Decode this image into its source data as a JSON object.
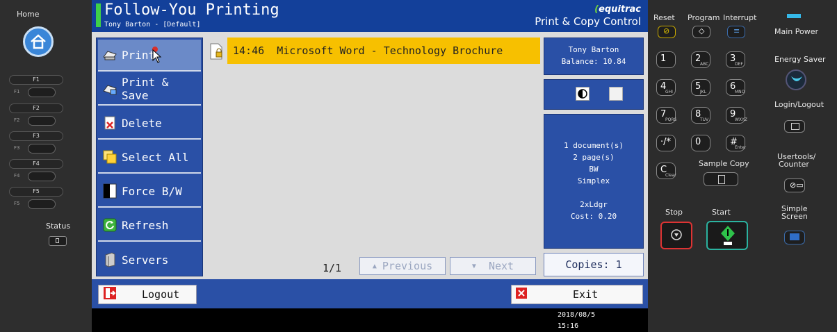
{
  "left_panel": {
    "home_label": "Home",
    "fkeys": [
      {
        "label": "F1",
        "small": "F1"
      },
      {
        "label": "F2",
        "small": "F2"
      },
      {
        "label": "F3",
        "small": "F3"
      },
      {
        "label": "F4",
        "small": "F4"
      },
      {
        "label": "F5",
        "small": "F5"
      }
    ],
    "status_label": "Status"
  },
  "header": {
    "title": "Follow-You Printing",
    "user": "Tony Barton - [Default]",
    "brand": "equitrac",
    "subtitle": "Print & Copy Control"
  },
  "sidebar": {
    "items": [
      {
        "label": "Print",
        "icon": "printer-icon"
      },
      {
        "label": "Print & Save",
        "icon": "print-save-icon"
      },
      {
        "label": "Delete",
        "icon": "delete-icon"
      },
      {
        "label": "Select All",
        "icon": "select-all-icon"
      },
      {
        "label": "Force B/W",
        "icon": "force-bw-icon"
      },
      {
        "label": "Refresh",
        "icon": "refresh-icon"
      },
      {
        "label": "Servers",
        "icon": "servers-icon"
      }
    ]
  },
  "job": {
    "time": "14:46",
    "name": "Microsoft Word - Technology Brochure"
  },
  "pagination": {
    "counter": "1/1",
    "previous": "Previous",
    "next": "Next"
  },
  "user_box": {
    "name": "Tony Barton",
    "balance": "Balance: 10.84"
  },
  "summary": {
    "documents": "1 document(s)",
    "pages": "2 page(s)",
    "color": "BW",
    "duplex": "Simplex",
    "paper": "2xLdgr",
    "cost": "Cost: 0.20"
  },
  "copies": "Copies: 1",
  "bottom": {
    "logout": "Logout",
    "exit": "Exit"
  },
  "status": {
    "date": "2018/08/5",
    "time": "15:16"
  },
  "right_panel": {
    "reset": "Reset",
    "program": "Program",
    "interrupt": "Interrupt",
    "main_power": "Main Power",
    "energy_saver": "Energy Saver",
    "login_logout": "Login/Logout",
    "usertools": "Usertools/",
    "counter": "Counter",
    "sample_copy": "Sample Copy",
    "stop": "Stop",
    "start": "Start",
    "simple": "Simple",
    "screen": "Screen",
    "keys": [
      {
        "d": "1",
        "s": ""
      },
      {
        "d": "2",
        "s": "ABC"
      },
      {
        "d": "3",
        "s": "DEF"
      },
      {
        "d": "4",
        "s": "GHI"
      },
      {
        "d": "5",
        "s": "JKL"
      },
      {
        "d": "6",
        "s": "MNO"
      },
      {
        "d": "7",
        "s": "PQRS"
      },
      {
        "d": "8",
        "s": "TUV"
      },
      {
        "d": "9",
        "s": "WXYZ"
      },
      {
        "d": "·/*",
        "s": ""
      },
      {
        "d": "0",
        "s": ""
      },
      {
        "d": "#",
        "s": "Enter"
      }
    ],
    "clear_d": "C",
    "clear_s": "Clear"
  },
  "colors": {
    "screen_blue": "#2a50a6",
    "title_blue": "#13409a",
    "job_highlight": "#f7c000",
    "accent_green": "#3fcf48"
  }
}
